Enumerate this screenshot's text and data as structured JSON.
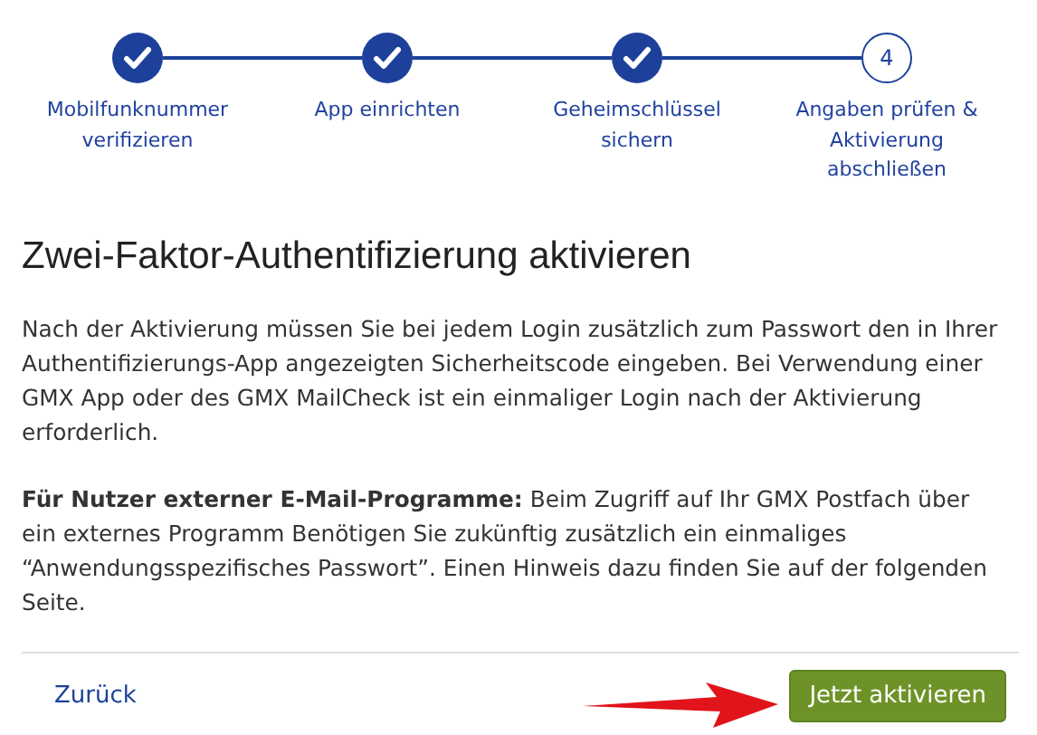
{
  "steps": [
    {
      "label": "Mobilfunknummer verifizieren",
      "done": true
    },
    {
      "label": "App einrichten",
      "done": true
    },
    {
      "label": "Geheimschlüssel sichern",
      "done": true
    },
    {
      "label": "Angaben prüfen & Aktivierung abschließen",
      "done": false,
      "number": "4"
    }
  ],
  "heading": "Zwei-Faktor-Authentifizierung aktivieren",
  "paragraphs": [
    "Nach der Aktivierung müssen Sie bei jedem Login zusätzlich zum Passwort den in Ihrer Authentifizierungs-App angezeigten Sicherheitscode eingeben. Bei Verwendung einer GMX App oder des GMX MailCheck ist ein einmaliger Login nach der Aktivierung erforderlich.",
    "**Für Nutzer externer E-Mail-Programme:** Beim Zugriff auf Ihr GMX Postfach über ein externes Programm Benötigen Sie zukünftig zusätzlich ein einmaliges “Anwendungsspezifisches Passwort”. Einen Hinweis dazu finden Sie auf der folgenden Seite."
  ],
  "footer": {
    "back_link": "Zurück",
    "primary_button": "Jetzt aktivieren",
    "annotation": {
      "kind": "arrow"
    }
  }
}
